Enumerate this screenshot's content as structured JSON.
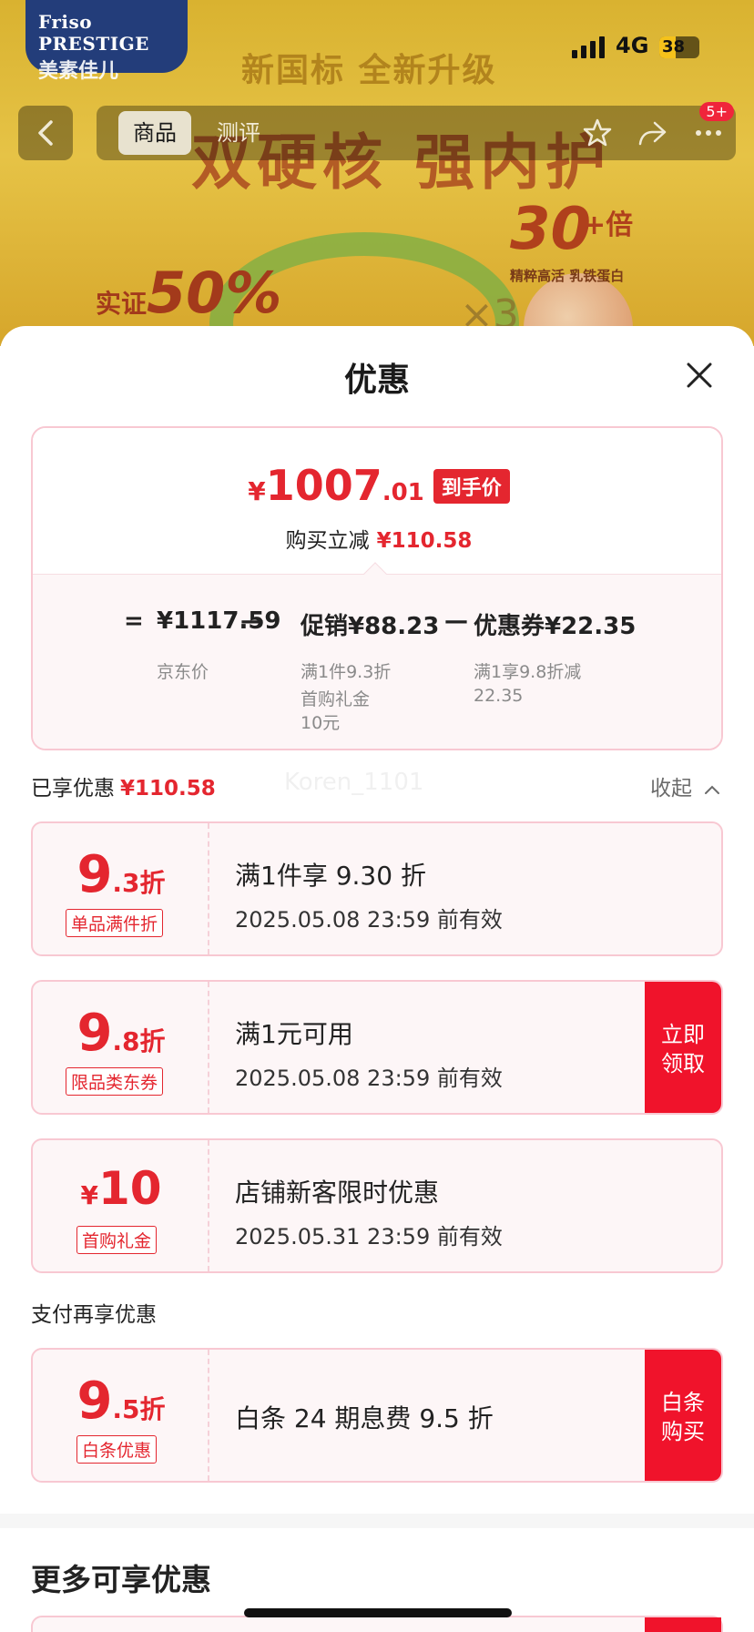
{
  "background": {
    "brand_logo_en": "Friso PRESTIGE",
    "brand_logo_cn": "美素佳儿",
    "slogan": "新国标 全新升级",
    "headline": "双硬核 强内护",
    "promo_30": "30",
    "promo_30_sup": "+倍",
    "promo_30_sub": "精粹高活 乳铁蛋白",
    "promo_50_prefix": "实证",
    "promo_50": "50%",
    "promo_x3": "×3"
  },
  "status_bar": {
    "network": "4G",
    "battery": "38"
  },
  "nav": {
    "tabs": [
      {
        "label": "商品"
      },
      {
        "label": "测评"
      }
    ],
    "more_badge": "5+"
  },
  "sheet": {
    "title": "优惠",
    "summary": {
      "currency": "¥",
      "price_int": "1007",
      "price_dec": ".01",
      "price_tag": "到手价",
      "reduce_label": "购买立减",
      "reduce_value": "¥110.58",
      "calc": {
        "eq": "=",
        "minus": "—",
        "jd_price": "¥1117.59",
        "jd_label": "京东价",
        "promo": "促销¥88.23",
        "promo_note1": "满1件9.3折",
        "promo_note2": "首购礼金\n10元",
        "coupon": "优惠券¥22.35",
        "coupon_note": "满1享9.8折减\n22.35"
      }
    },
    "enjoyed_label": "已享优惠",
    "enjoyed_value": "¥110.58",
    "collapse_label": "收起",
    "watermark": "Koren_1101",
    "coupons": [
      {
        "big": "9",
        "small": ".3折",
        "tag": "单品满件折",
        "title": "满1件享 9.30 折",
        "valid": "2025.05.08 23:59 前有效"
      },
      {
        "big": "9",
        "small": ".8折",
        "tag": "限品类东券",
        "title": "满1元可用",
        "valid": "2025.05.08 23:59 前有效",
        "action": "立即领取"
      },
      {
        "big_prefix": "¥",
        "big": "10",
        "tag": "首购礼金",
        "title": "店铺新客限时优惠",
        "valid": "2025.05.31 23:59 前有效"
      }
    ],
    "pay_section_label": "支付再享优惠",
    "pay_coupon": {
      "big": "9",
      "small": ".5折",
      "tag": "白条优惠",
      "title": "白条 24 期息费 9.5 折",
      "action": "白条购买"
    },
    "more_title": "更多可享优惠"
  },
  "colors": {
    "accent_red": "#e4262f",
    "action_red": "#f0132b",
    "border_pink": "#f8c8d2"
  }
}
